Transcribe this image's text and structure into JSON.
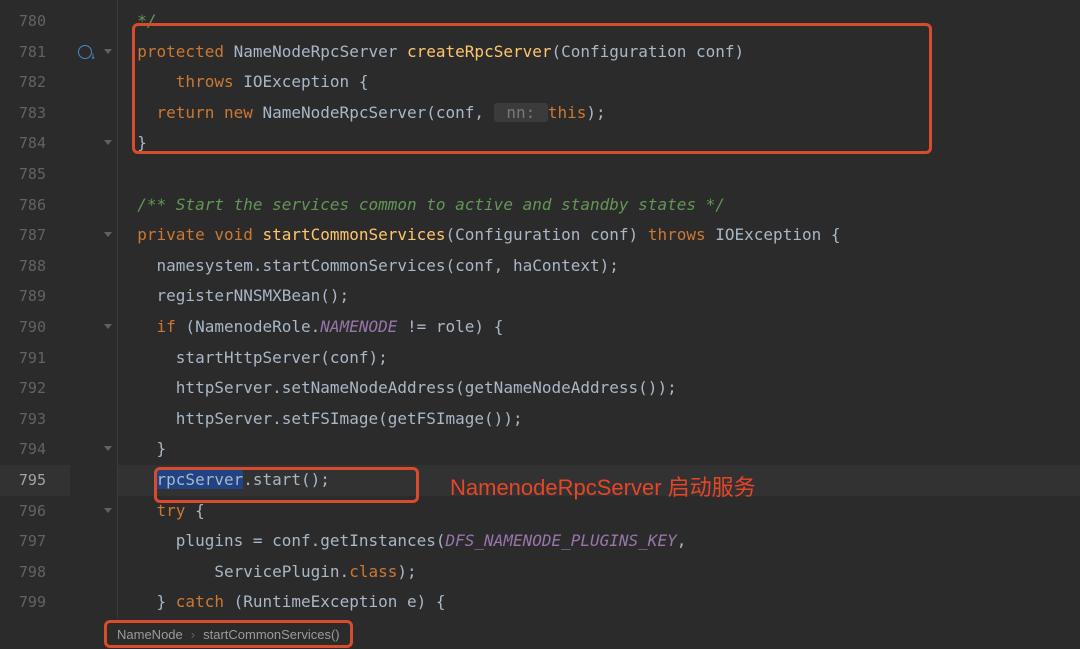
{
  "lines": {
    "l780": "  */",
    "l781a": "  protected",
    "l781b": " NameNodeRpcServer ",
    "l781c": "createRpcServer",
    "l781d": "(Configuration conf)",
    "l782a": "      throws",
    "l782b": " IOException {",
    "l783a": "    return new",
    "l783b": " NameNodeRpcServer(conf, ",
    "l783h": " nn: ",
    "l783c": "this",
    "l783d": ");",
    "l784": "  }",
    "l785": "",
    "l786": "  /** Start the services common to active and standby states */",
    "l787a": "  private void",
    "l787b": " ",
    "l787c": "startCommonServices",
    "l787d": "(Configuration conf) ",
    "l787e": "throws",
    "l787f": " IOException {",
    "l788": "    namesystem.startCommonServices(conf, haContext);",
    "l789": "    registerNNSMXBean();",
    "l790a": "    if",
    "l790b": " (NamenodeRole.",
    "l790c": "NAMENODE",
    "l790d": " != role) {",
    "l791": "      startHttpServer(conf);",
    "l792": "      httpServer.setNameNodeAddress(getNameNodeAddress());",
    "l793": "      httpServer.setFSImage(getFSImage());",
    "l794": "    }",
    "l795a": "    ",
    "l795sel": "rpcServer",
    "l795b": ".start();",
    "l796a": "    try",
    "l796b": " {",
    "l797a": "      plugins = conf.getInstances(",
    "l797b": "DFS_NAMENODE_PLUGINS_KEY",
    "l797c": ",",
    "l798a": "          ServicePlugin.",
    "l798b": "class",
    "l798c": ");",
    "l799a": "    } ",
    "l799b": "catch",
    "l799c": " (RuntimeException e) {"
  },
  "lineNumbers": [
    "780",
    "781",
    "782",
    "783",
    "784",
    "785",
    "786",
    "787",
    "788",
    "789",
    "790",
    "791",
    "792",
    "793",
    "794",
    "795",
    "796",
    "797",
    "798",
    "799"
  ],
  "currentLine": "795",
  "annotation": "NamenodeRpcServer 启动服务",
  "breadcrumb": {
    "item1": "NameNode",
    "item2": "startCommonServices()"
  },
  "icons": {
    "override": "override-down-icon"
  }
}
